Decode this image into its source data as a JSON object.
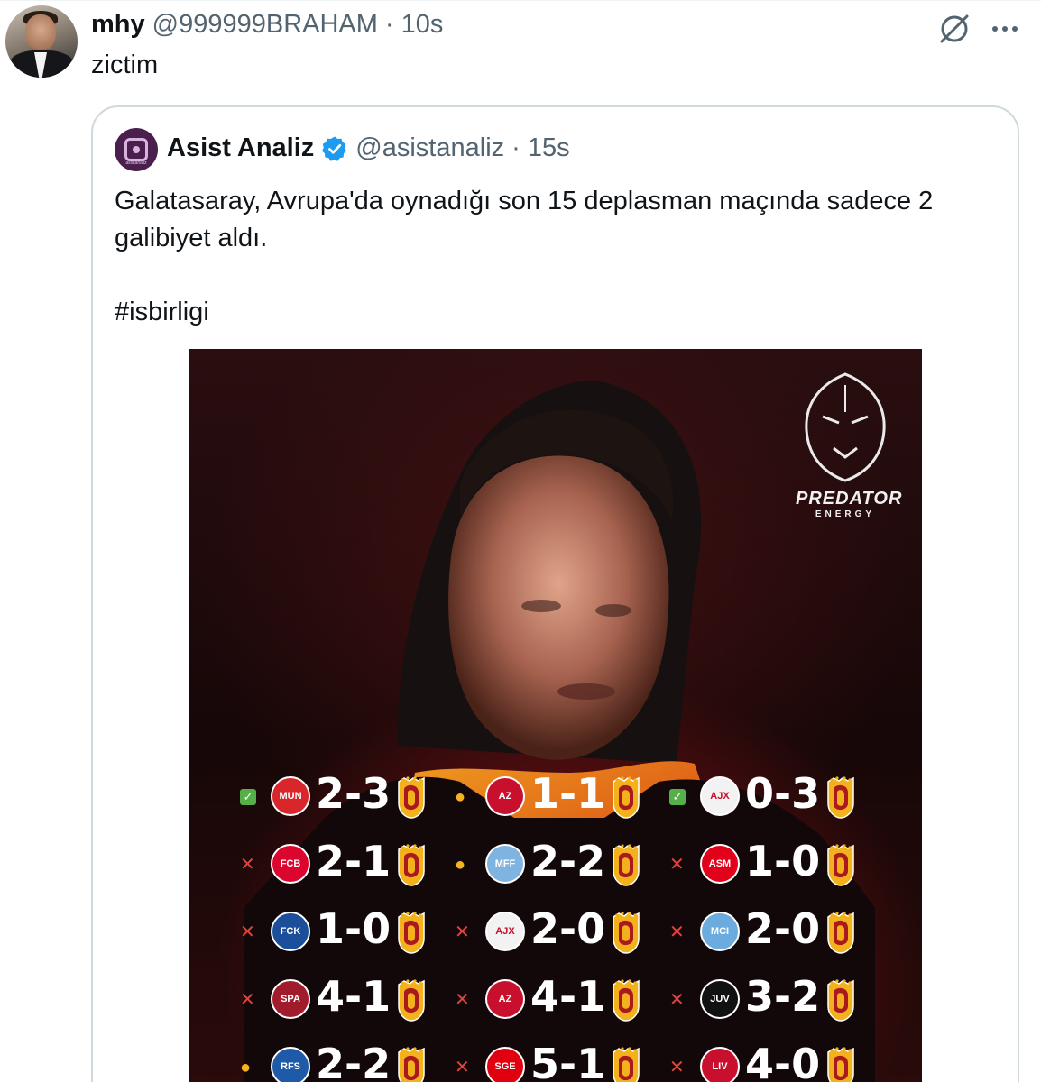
{
  "tweet": {
    "author_name": "mhy",
    "author_handle": "@999999BRAHAM",
    "separator": "·",
    "time": "10s",
    "text": "zictim"
  },
  "icons": {
    "grok": "grok-icon",
    "more": "more-icon",
    "verified": "verified-badge-icon"
  },
  "quote": {
    "author_name": "Asist Analiz",
    "author_handle": "@asistanaliz",
    "separator": "·",
    "time": "15s",
    "avatar_text": "asistanaliz",
    "text_line1": "Galatasaray, Avrupa'da oynadığı son 15 deplasman maçında sadece 2",
    "text_line2": "galibiyet aldı.",
    "hashtag": "#isbirligi"
  },
  "media": {
    "sponsor_word": "PREDATOR",
    "sponsor_sub": "ENERGY",
    "results": [
      [
        {
          "status": "win",
          "status_glyph": "✓",
          "opponent": "MUN",
          "crest_color": "#d8262b",
          "score": "2-3"
        },
        {
          "status": "draw",
          "status_glyph": "●",
          "opponent": "AZ",
          "crest_color": "#c8102e",
          "score": "1-1"
        },
        {
          "status": "win",
          "status_glyph": "✓",
          "opponent": "AJX",
          "crest_color": "#f2f2f2",
          "score": "0-3"
        }
      ],
      [
        {
          "status": "loss",
          "status_glyph": "✕",
          "opponent": "FCB",
          "crest_color": "#dc052d",
          "score": "2-1"
        },
        {
          "status": "draw",
          "status_glyph": "●",
          "opponent": "MFF",
          "crest_color": "#7fb3e0",
          "score": "2-2"
        },
        {
          "status": "loss",
          "status_glyph": "✕",
          "opponent": "ASM",
          "crest_color": "#e2001a",
          "score": "1-0"
        }
      ],
      [
        {
          "status": "loss",
          "status_glyph": "✕",
          "opponent": "FCK",
          "crest_color": "#1b4f9c",
          "score": "1-0"
        },
        {
          "status": "loss",
          "status_glyph": "✕",
          "opponent": "AJX",
          "crest_color": "#f2f2f2",
          "score": "2-0"
        },
        {
          "status": "loss",
          "status_glyph": "✕",
          "opponent": "MCI",
          "crest_color": "#6cabdd",
          "score": "2-0"
        }
      ],
      [
        {
          "status": "loss",
          "status_glyph": "✕",
          "opponent": "SPA",
          "crest_color": "#a01c2d",
          "score": "4-1"
        },
        {
          "status": "loss",
          "status_glyph": "✕",
          "opponent": "AZ",
          "crest_color": "#c8102e",
          "score": "4-1"
        },
        {
          "status": "loss",
          "status_glyph": "✕",
          "opponent": "JUV",
          "crest_color": "#111111",
          "score": "3-2"
        }
      ],
      [
        {
          "status": "draw",
          "status_glyph": "●",
          "opponent": "RFS",
          "crest_color": "#1e5aa8",
          "score": "2-2"
        },
        {
          "status": "loss",
          "status_glyph": "✕",
          "opponent": "SGE",
          "crest_color": "#e1000f",
          "score": "5-1"
        },
        {
          "status": "loss",
          "status_glyph": "✕",
          "opponent": "LIV",
          "crest_color": "#c8102e",
          "score": "4-0"
        }
      ]
    ]
  }
}
